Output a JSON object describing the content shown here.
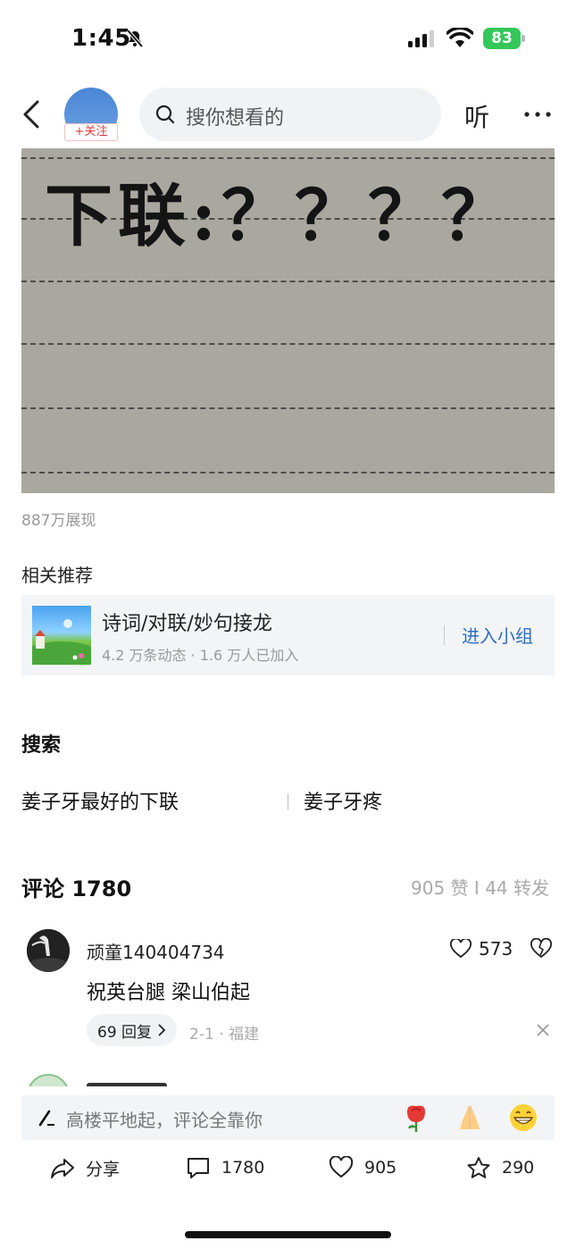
{
  "status_bar": {
    "time": "1:45",
    "battery": "83"
  },
  "header": {
    "follow_label": "+关注",
    "search_placeholder": "搜你想看的",
    "listen_label": "听"
  },
  "post": {
    "image_text": "下联:？？？？",
    "views": "887万展现"
  },
  "related": {
    "title": "相关推荐",
    "group": {
      "name": "诗词/对联/妙句接龙",
      "meta": "4.2 万条动态 · 1.6 万人已加入",
      "join_label": "进入小组"
    }
  },
  "search": {
    "title": "搜索",
    "items": [
      "姜子牙最好的下联",
      "姜子牙疼"
    ]
  },
  "comments": {
    "title": "评论 1780",
    "stats": "905 赞 Ι 44 转发",
    "items": [
      {
        "user": "顽童140404734",
        "likes": "573",
        "text": "祝英台腿 梁山伯起",
        "replies": "69 回复",
        "meta": "2-1 · 福建"
      }
    ]
  },
  "input": {
    "placeholder": "高楼平地起，评论全靠你"
  },
  "actions": {
    "share": "分享",
    "comments": "1780",
    "likes": "905",
    "favorites": "290"
  },
  "colors": {
    "accent": "#2f6fc2",
    "follow": "#e23b3b",
    "battery": "#34c759"
  }
}
